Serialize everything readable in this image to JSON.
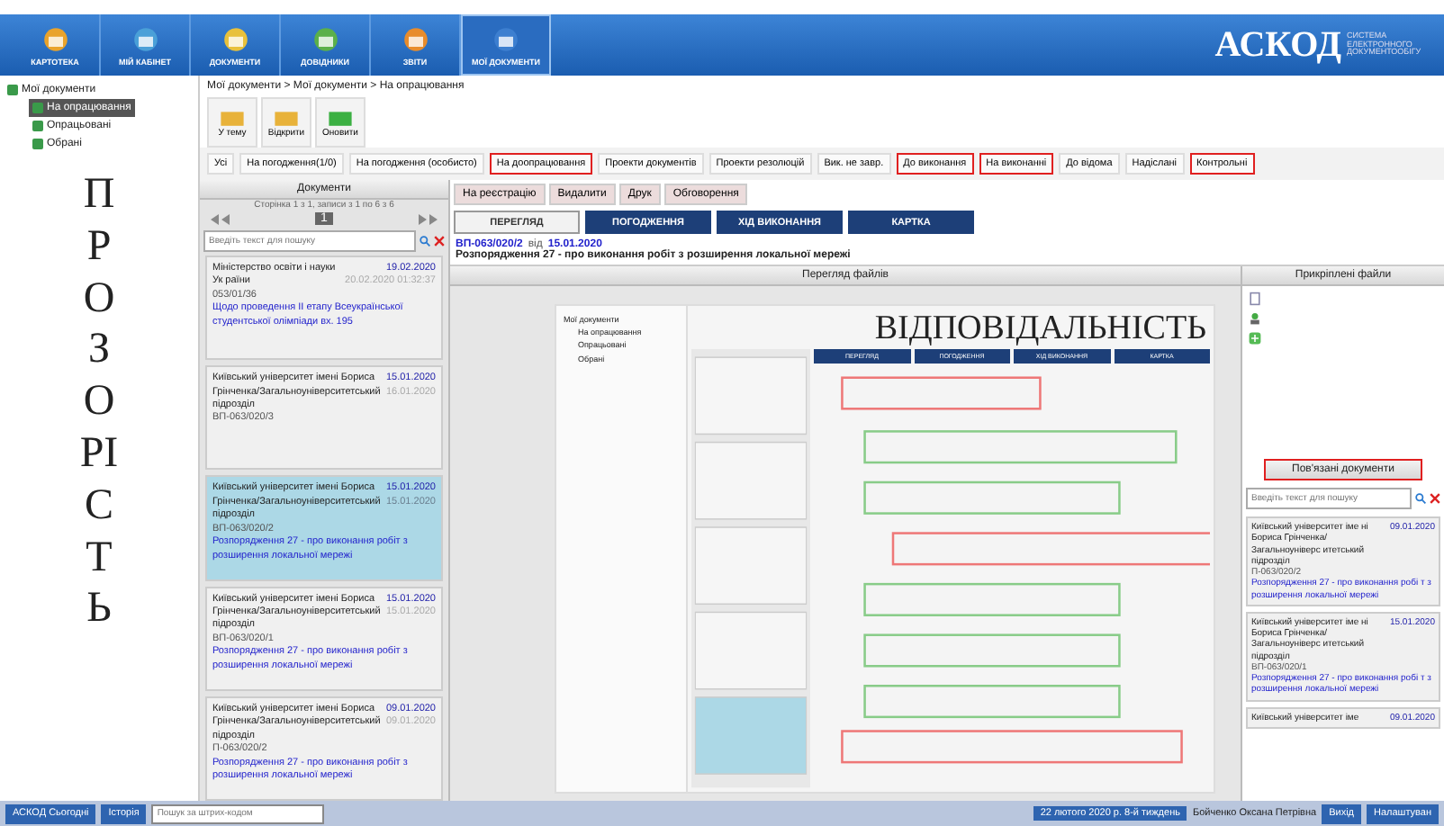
{
  "nav": {
    "tiles": [
      {
        "label": "КАРТОТЕКА",
        "selected": false
      },
      {
        "label": "МІЙ КАБІНЕТ",
        "selected": false
      },
      {
        "label": "ДОКУМЕНТИ",
        "selected": false
      },
      {
        "label": "ДОВІДНИКИ",
        "selected": false
      },
      {
        "label": "ЗВІТИ",
        "selected": false
      },
      {
        "label": "МОЇ ДОКУМЕНТИ",
        "selected": true
      }
    ],
    "logo": {
      "name": "АСКОД",
      "tagline": "СИСТЕМА ЕЛЕКТРОННОГО ДОКУМЕНТООБІГУ"
    }
  },
  "tree": {
    "label": "Мої документи",
    "children": [
      {
        "label": "На опрацювання",
        "selected": true
      },
      {
        "label": "Опрацьовані",
        "selected": false
      },
      {
        "label": "Обрані",
        "selected": false
      }
    ]
  },
  "overlay_left": "ПРОЗОРІСТЬ",
  "breadcrumb": "Мої документи > Мої документи > На опрацювання",
  "toolbar": [
    "У тему",
    "Відкрити",
    "Оновити"
  ],
  "filters": [
    {
      "label": "Усі",
      "highlighted": false
    },
    {
      "label": "На погодження(1/0)",
      "highlighted": false
    },
    {
      "label": "На погодження (особисто)",
      "highlighted": false
    },
    {
      "label": "На доопрацювання",
      "highlighted": true
    },
    {
      "label": "Проекти документів",
      "highlighted": false
    },
    {
      "label": "Проекти резолюцій",
      "highlighted": false
    },
    {
      "label": "Вик. не завр.",
      "highlighted": false
    },
    {
      "label": "До виконання",
      "highlighted": true
    },
    {
      "label": "На виконанні",
      "highlighted": true
    },
    {
      "label": "До відома",
      "highlighted": false
    },
    {
      "label": "Надіслані",
      "highlighted": false
    },
    {
      "label": "Контрольні",
      "highlighted": true
    }
  ],
  "documents": {
    "title": "Документи",
    "paging": "Сторінка 1 з 1, записи з 1 по 6 з 6",
    "page": "1",
    "search": {
      "placeholder": "Введіть текст для пошуку"
    },
    "cards": [
      {
        "org": "Міністерство освіти і науки Ук раїни",
        "date": "19.02.2020",
        "time": "20.02.2020 01:32:37",
        "number": "053/01/36",
        "subject": "Щодо проведення ІІ етапу Всеукраїнської студентської олімпіади вх. 195",
        "selected": false
      },
      {
        "org": "Київський університет імені Бориса Грінченка/Загальноуніверситетський підрозділ",
        "date": "15.01.2020",
        "time": "16.01.2020",
        "number": "ВП-063/020/3",
        "selected": false
      },
      {
        "org": "Київський університет імені Бориса Грінченка/Загальноуніверситетський підрозділ",
        "date": "15.01.2020",
        "time": "15.01.2020",
        "number": "ВП-063/020/2",
        "subject": "Розпорядження 27 - про виконання робіт з розширення локальної мережі",
        "selected": true
      },
      {
        "org": "Київський університет імені Бориса Грінченка/Загальноуніверситетський підрозділ",
        "date": "15.01.2020",
        "time": "15.01.2020",
        "number": "ВП-063/020/1",
        "subject": "Розпорядження 27 - про виконання робіт з розширення локальної мережі",
        "selected": false
      },
      {
        "org": "Київський університет імені Бориса Грінченка/Загальноуніверситетський підрозділ",
        "date": "09.01.2020",
        "time": "09.01.2020",
        "number": "П-063/020/2",
        "subject": "Розпорядження 27 - про виконання робіт з розширення локальної мережі",
        "selected": false
      }
    ]
  },
  "viewer": {
    "actions": [
      "На реєстрацію",
      "Видалити",
      "Друк",
      "Обговорення"
    ],
    "tabs": [
      {
        "label": "ПЕРЕГЛЯД",
        "selected": true
      },
      {
        "label": "ПОГОДЖЕННЯ",
        "selected": false
      },
      {
        "label": "ХІД ВИКОНАННЯ",
        "selected": false
      },
      {
        "label": "КАРТКА",
        "selected": false
      }
    ],
    "doc_number": "ВП-063/020/2",
    "doc_from": "від",
    "doc_date": "15.01.2020",
    "doc_title": "Розпорядження 27 - про виконання робіт з розширення локальної мережі",
    "files_title": "Перегляд файлів",
    "inner": {
      "overlay": "ВІДПОВІДАЛЬНІСТЬ",
      "tree": [
        "Мої документи",
        "На опрацювання",
        "Опрацьовані",
        "Обрані"
      ],
      "tabs": [
        "ПЕРЕГЛЯД",
        "ПОГОДЖЕННЯ",
        "ХІД ВИКОНАННЯ",
        "КАРТКА"
      ]
    }
  },
  "attached": {
    "title": "Прикріплені файли"
  },
  "related": {
    "title": "Пов'язані документи",
    "highlighted": true,
    "search": {
      "placeholder": "Введіть текст для пошуку"
    },
    "cards": [
      {
        "org": "Київський університет іме ні Бориса Грінченка/Загальноуніверс итетський підрозділ",
        "date": "09.01.2020",
        "number": "П-063/020/2",
        "subject": "Розпорядження 27 - про виконання робі т з розширення локальної мережі"
      },
      {
        "org": "Київський університет іме ні Бориса Грінченка/Загальноуніверс итетський підрозділ",
        "date": "15.01.2020",
        "number": "ВП-063/020/1",
        "subject": "Розпорядження 27 - про виконання робі т з розширення локальної мережі"
      },
      {
        "org": "Київський університет іме",
        "date": "09.01.2020"
      }
    ]
  },
  "taskbar": {
    "start": "АСКОД Сьогодні",
    "history": "Історія",
    "barcode": {
      "placeholder": "Пошук за штрих-кодом"
    },
    "date": "22 лютого 2020 р. 8-й тиждень",
    "user": "Бойченко Оксана Петрівна",
    "exit": "Вихід",
    "settings": "Налаштуван"
  }
}
